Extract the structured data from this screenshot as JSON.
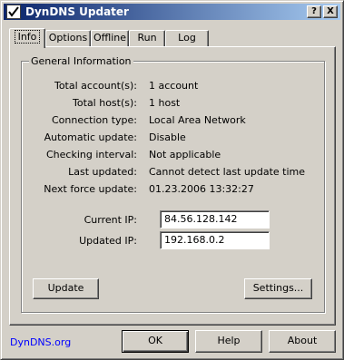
{
  "window": {
    "title": "DynDNS Updater",
    "help_label": "?",
    "close_label": "X"
  },
  "tabs": [
    {
      "label": "Info",
      "active": true
    },
    {
      "label": "Options"
    },
    {
      "label": "Offline"
    },
    {
      "label": "Run"
    },
    {
      "label": "Log"
    }
  ],
  "general": {
    "legend": "General Information",
    "rows": [
      {
        "label": "Total account(s):",
        "value": "1 account"
      },
      {
        "label": "Total host(s):",
        "value": "1 host"
      },
      {
        "label": "Connection type:",
        "value": "Local Area Network"
      },
      {
        "label": "Automatic update:",
        "value": "Disable"
      },
      {
        "label": "Checking interval:",
        "value": "Not applicable"
      },
      {
        "label": "Last updated:",
        "value": "Cannot detect last update time"
      },
      {
        "label": "Next force update:",
        "value": "01.23.2006 13:32:27"
      }
    ],
    "current_ip_label": "Current IP:",
    "current_ip_value": "84.56.128.142",
    "updated_ip_label": "Updated IP:",
    "updated_ip_value": "192.168.0.2",
    "update_button": "Update",
    "settings_button": "Settings..."
  },
  "footer": {
    "link": "DynDNS.org",
    "ok_button": "OK",
    "help_button": "Help",
    "about_button": "About"
  },
  "colors": {
    "title_start": "#0a246a",
    "title_end": "#a6caf0",
    "face": "#d4d0c8",
    "link": "#0000ff"
  }
}
